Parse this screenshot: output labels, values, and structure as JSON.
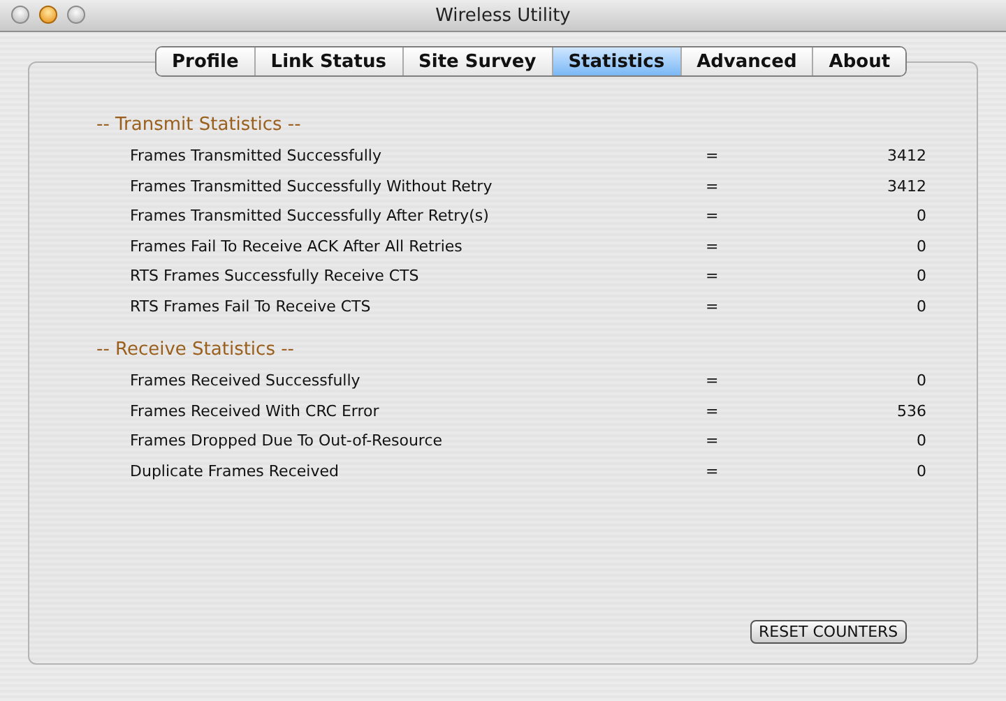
{
  "window": {
    "title": "Wireless Utility"
  },
  "tabs": [
    {
      "label": "Profile",
      "selected": false
    },
    {
      "label": "Link Status",
      "selected": false
    },
    {
      "label": "Site Survey",
      "selected": false
    },
    {
      "label": "Statistics",
      "selected": true
    },
    {
      "label": "Advanced",
      "selected": false
    },
    {
      "label": "About",
      "selected": false
    }
  ],
  "sections": [
    {
      "title": "-- Transmit Statistics --",
      "rows": [
        {
          "label": "Frames Transmitted Successfully",
          "sign": "=",
          "value": "3412"
        },
        {
          "label": "Frames Transmitted Successfully Without Retry",
          "sign": "=",
          "value": "3412"
        },
        {
          "label": "Frames Transmitted Successfully After Retry(s)",
          "sign": "=",
          "value": "0"
        },
        {
          "label": "Frames Fail To Receive ACK After All Retries",
          "sign": "=",
          "value": "0"
        },
        {
          "label": "RTS Frames Successfully Receive CTS",
          "sign": "=",
          "value": "0"
        },
        {
          "label": "RTS Frames Fail To Receive CTS",
          "sign": "=",
          "value": "0"
        }
      ]
    },
    {
      "title": "-- Receive Statistics --",
      "rows": [
        {
          "label": "Frames Received Successfully",
          "sign": "=",
          "value": "0"
        },
        {
          "label": "Frames Received With CRC Error",
          "sign": "=",
          "value": "536"
        },
        {
          "label": "Frames Dropped Due To Out-of-Resource",
          "sign": "=",
          "value": "0"
        },
        {
          "label": "Duplicate Frames Received",
          "sign": "=",
          "value": "0"
        }
      ]
    }
  ],
  "reset_button": "RESET COUNTERS"
}
